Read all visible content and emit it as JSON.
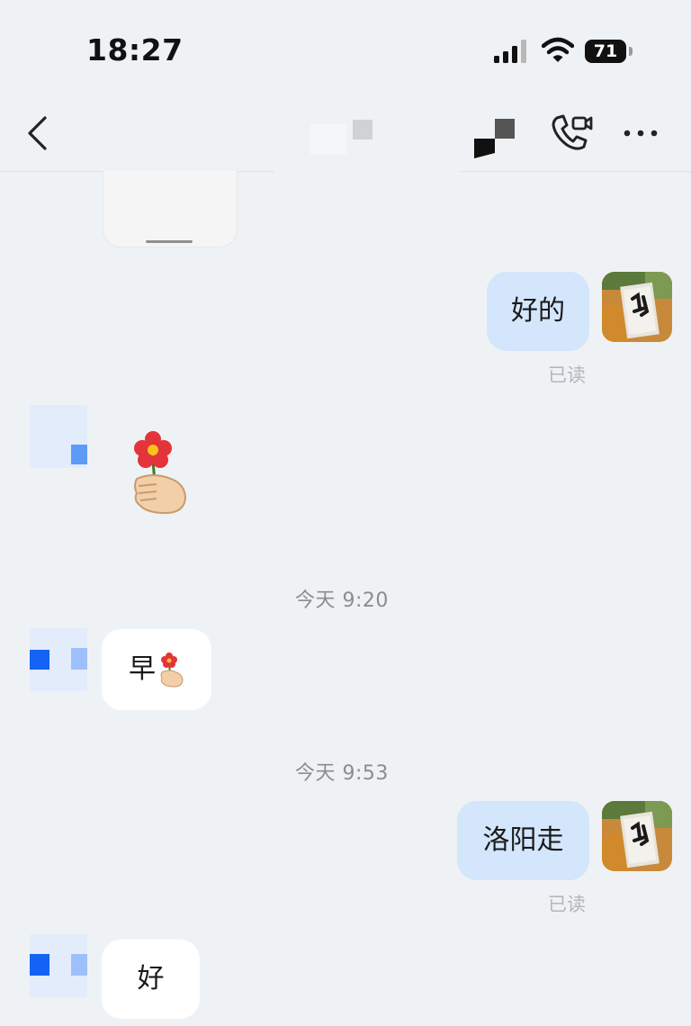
{
  "status_bar": {
    "time": "18:27",
    "battery": "71"
  },
  "nav": {
    "back_icon": "chevron-left-icon",
    "video_call_icon": "phone-video-icon",
    "more_icon": "more-horizontal-icon"
  },
  "messages": [
    {
      "side": "me",
      "text": "好的",
      "status": "已读"
    },
    {
      "side": "them",
      "sticker": "hand-holding-flower-emoji"
    },
    {
      "timestamp": "今天 9:20"
    },
    {
      "side": "them",
      "text": "早"
    },
    {
      "timestamp": "今天 9:53"
    },
    {
      "side": "me",
      "text": "洛阳走",
      "status": "已读"
    },
    {
      "side": "them",
      "text": "好"
    }
  ],
  "colors": {
    "background": "#eff2f5",
    "my_bubble": "#d3e6fb",
    "their_bubble": "#ffffff",
    "accent_blue": "#1463f5"
  }
}
